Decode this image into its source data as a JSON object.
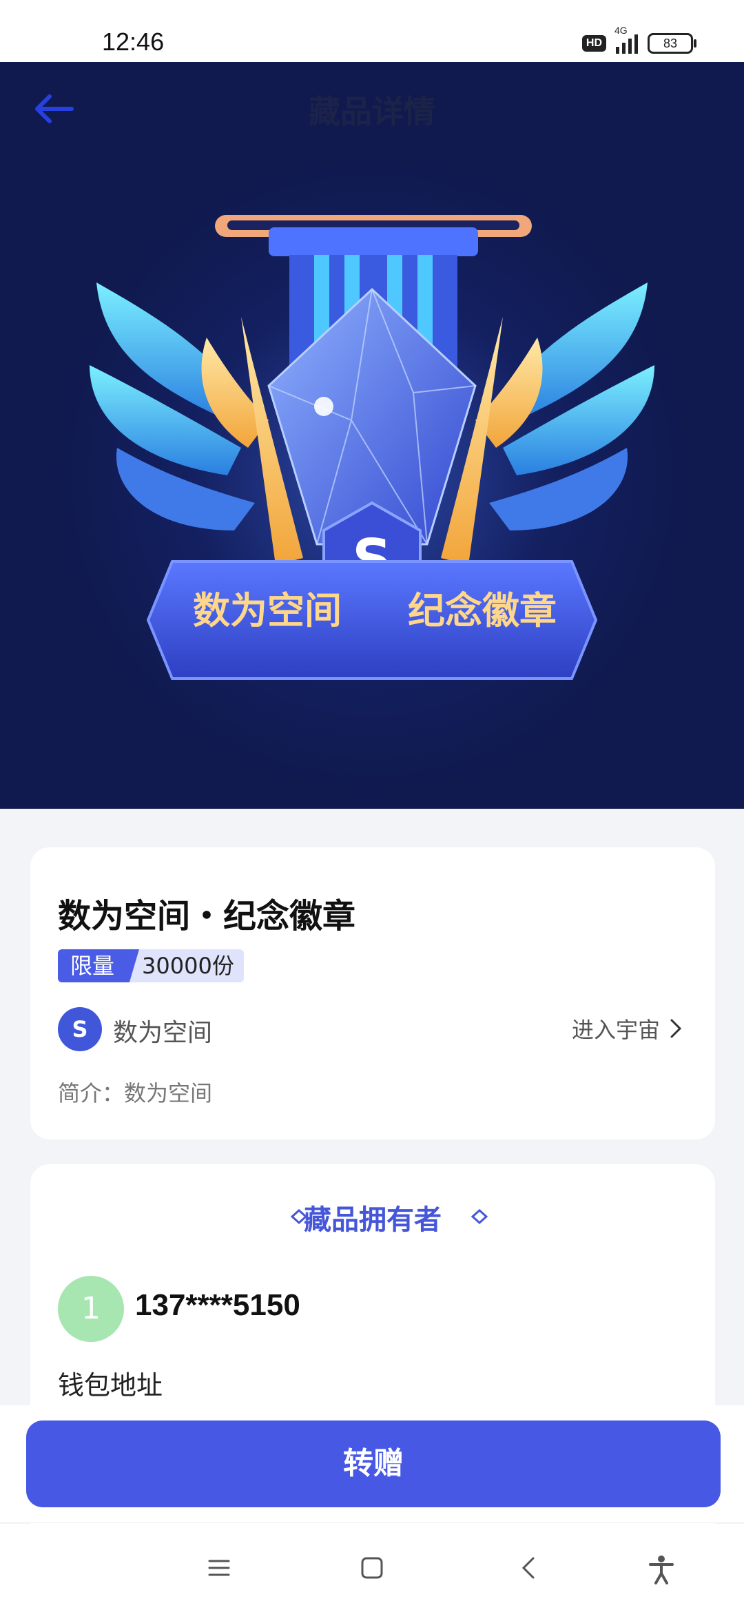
{
  "status": {
    "time": "12:46",
    "hd": "HD",
    "network": "4G",
    "battery": "83"
  },
  "header": {
    "title": "藏品详情"
  },
  "hero": {
    "banner_left": "数为空间",
    "banner_right": "纪念徽章"
  },
  "collection": {
    "title": "数为空间・纪念徽章",
    "limit_label": "限量",
    "limit_count": "30000份",
    "creator": "数为空间",
    "enter_label": "进入宇宙",
    "intro": "简介：数为空间"
  },
  "owner": {
    "section_title": "藏品拥有者",
    "avatar_text": "1",
    "phone": "137****5150",
    "wallet_label": "钱包地址"
  },
  "action": {
    "gift_label": "转赠"
  },
  "colors": {
    "accent": "#4658e4",
    "hero_bg": "#101a4f",
    "avatar_bg": "#a7e6b1"
  }
}
